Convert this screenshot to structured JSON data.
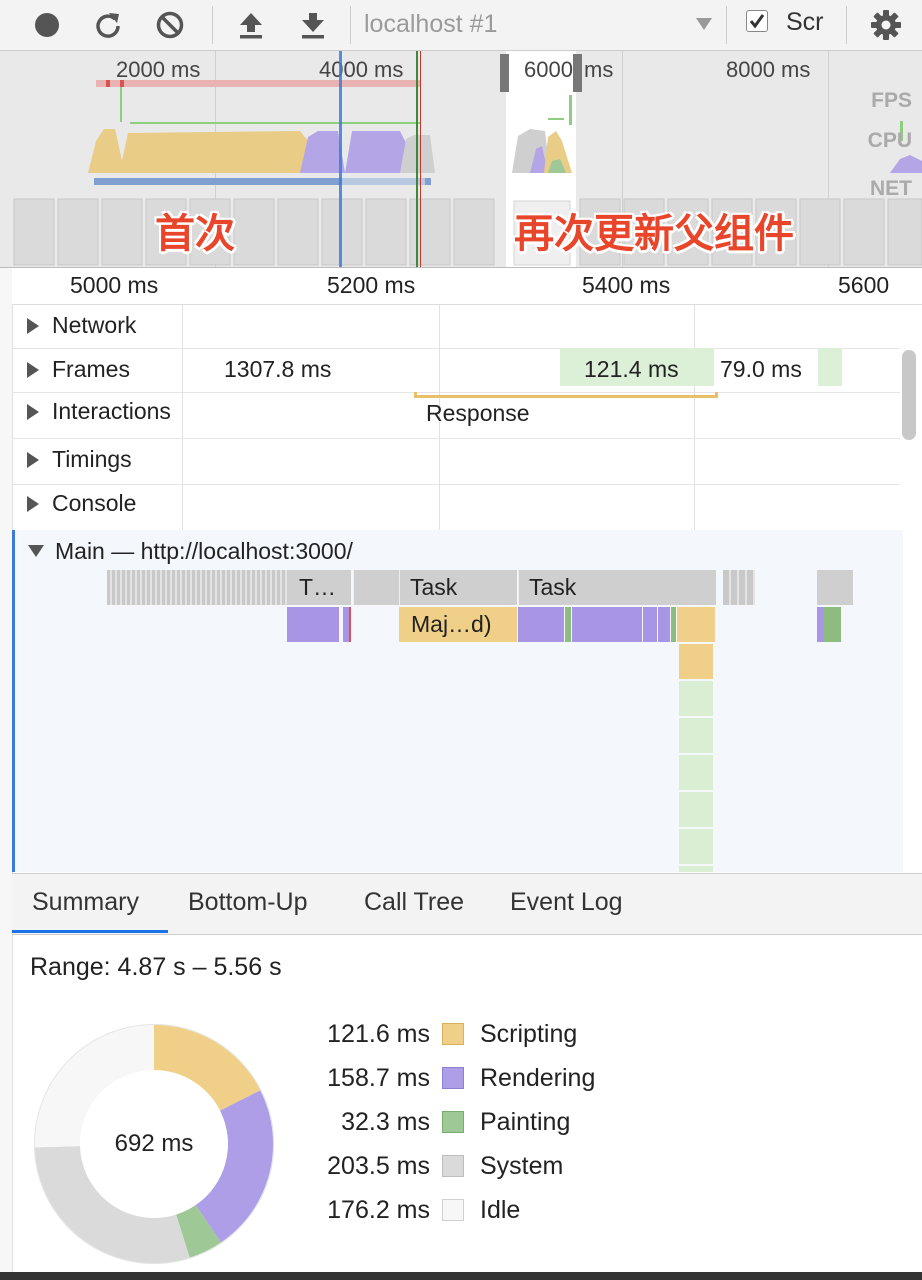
{
  "toolbar": {
    "url_select_value": "localhost #1",
    "screenshots_label": "Scr",
    "screenshots_checked": true
  },
  "overview": {
    "ticks": [
      "2000 ms",
      "4000 ms",
      "6000",
      "ms",
      "8000 ms"
    ],
    "lane_labels": {
      "fps": "FPS",
      "cpu": "CPU",
      "net": "NET"
    },
    "annotation_first": "首次",
    "annotation_second": "再次更新父组件"
  },
  "ruler": {
    "ticks": [
      "5000 ms",
      "5200 ms",
      "5400 ms",
      "5600"
    ]
  },
  "tracks": {
    "network": "Network",
    "frames": "Frames",
    "interactions": "Interactions",
    "timings": "Timings",
    "console": "Console"
  },
  "frames": {
    "f1": "1307.8 ms",
    "f2": "121.4 ms",
    "f3": "79.0 ms"
  },
  "interactions": {
    "response": "Response"
  },
  "main": {
    "label": "Main — http://localhost:3000/",
    "task_a": "T…",
    "task_b": "Task",
    "task_c": "Task",
    "major_gc": "Maj…d)"
  },
  "tabs": [
    "Summary",
    "Bottom-Up",
    "Call Tree",
    "Event Log"
  ],
  "summary": {
    "range": "Range: 4.87 s – 5.56 s",
    "total": "692 ms",
    "items": [
      {
        "value": "121.6 ms",
        "name": "Scripting",
        "color": "#f0d088",
        "border": "#d7b25a"
      },
      {
        "value": "158.7 ms",
        "name": "Rendering",
        "color": "#ae9ee8",
        "border": "#8f7fd0"
      },
      {
        "value": "32.3 ms",
        "name": "Painting",
        "color": "#9ec895",
        "border": "#7aab6f"
      },
      {
        "value": "203.5 ms",
        "name": "System",
        "color": "#dadada",
        "border": "#bdbdbd"
      },
      {
        "value": "176.2 ms",
        "name": "Idle",
        "color": "#f7f7f7",
        "border": "#d0d0d0"
      }
    ]
  }
}
